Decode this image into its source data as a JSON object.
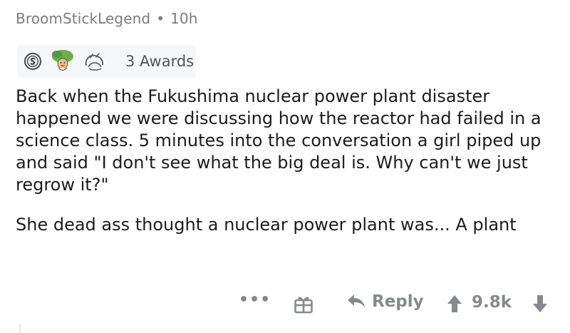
{
  "comment": {
    "author": "BroomStickLegend",
    "separator": "•",
    "time": "10h",
    "awards": {
      "label": "3 Awards",
      "icons": [
        "silver-award-icon",
        "wholesome-award-icon",
        "hugz-award-icon"
      ]
    },
    "paragraphs": [
      "Back when the Fukushima nuclear power plant disaster happened we were discussing how the reactor had failed in a science class. 5 minutes into the conversation a girl piped up and said \"I don't see what the big deal is. Why can't we just regrow it?\"",
      "She dead ass thought a nuclear power plant was... A plant"
    ]
  },
  "actions": {
    "more": "•••",
    "reply": "Reply",
    "score": "9.8k"
  },
  "colors": {
    "meta_text": "#7c7c7c",
    "action_gray": "#878a8c",
    "awards_bg": "#f6f7f8"
  }
}
